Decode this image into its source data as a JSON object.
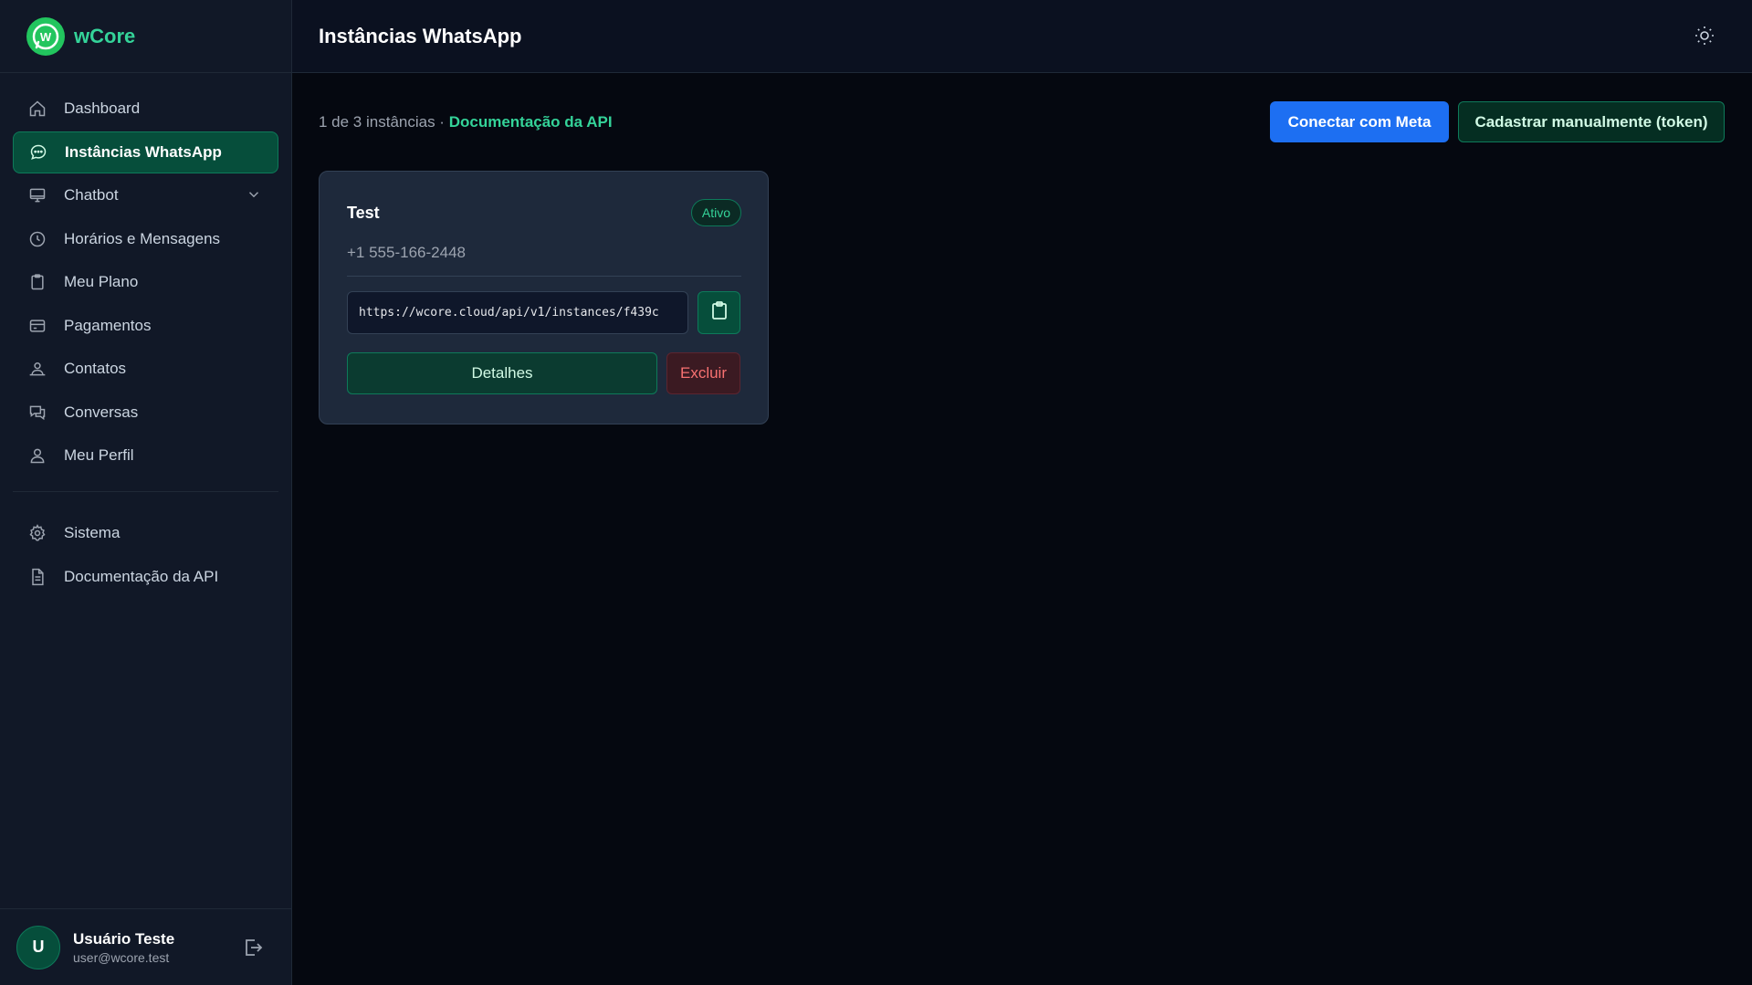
{
  "app": {
    "name": "wCore",
    "colors": {
      "accent": "#34d399",
      "primary": "#1d6ff2",
      "danger": "#f87171"
    }
  },
  "sidebar": {
    "items": [
      {
        "label": "Dashboard",
        "icon": "home-icon"
      },
      {
        "label": "Instâncias WhatsApp",
        "icon": "chat-bubble-icon",
        "active": true
      },
      {
        "label": "Chatbot",
        "icon": "monitor-icon",
        "expandable": true
      },
      {
        "label": "Horários e Mensagens",
        "icon": "clock-icon"
      },
      {
        "label": "Meu Plano",
        "icon": "clipboard-icon"
      },
      {
        "label": "Pagamentos",
        "icon": "credit-card-icon"
      },
      {
        "label": "Contatos",
        "icon": "contacts-icon"
      },
      {
        "label": "Conversas",
        "icon": "conversations-icon"
      },
      {
        "label": "Meu Perfil",
        "icon": "user-icon"
      }
    ],
    "secondary_items": [
      {
        "label": "Sistema",
        "icon": "gear-icon"
      },
      {
        "label": "Documentação da API",
        "icon": "document-icon"
      }
    ],
    "user": {
      "initial": "U",
      "name": "Usuário Teste",
      "email": "user@wcore.test"
    }
  },
  "header": {
    "title": "Instâncias WhatsApp"
  },
  "toolbar": {
    "count_text": "1 de 3 instâncias · ",
    "docs_link": "Documentação da API",
    "connect_label": "Conectar com Meta",
    "manual_label": "Cadastrar manualmente (token)"
  },
  "instances": [
    {
      "name": "Test",
      "status": "Ativo",
      "phone": "+1 555-166-2448",
      "url": "https://wcore.cloud/api/v1/instances/f439c",
      "details_label": "Detalhes",
      "delete_label": "Excluir"
    }
  ]
}
